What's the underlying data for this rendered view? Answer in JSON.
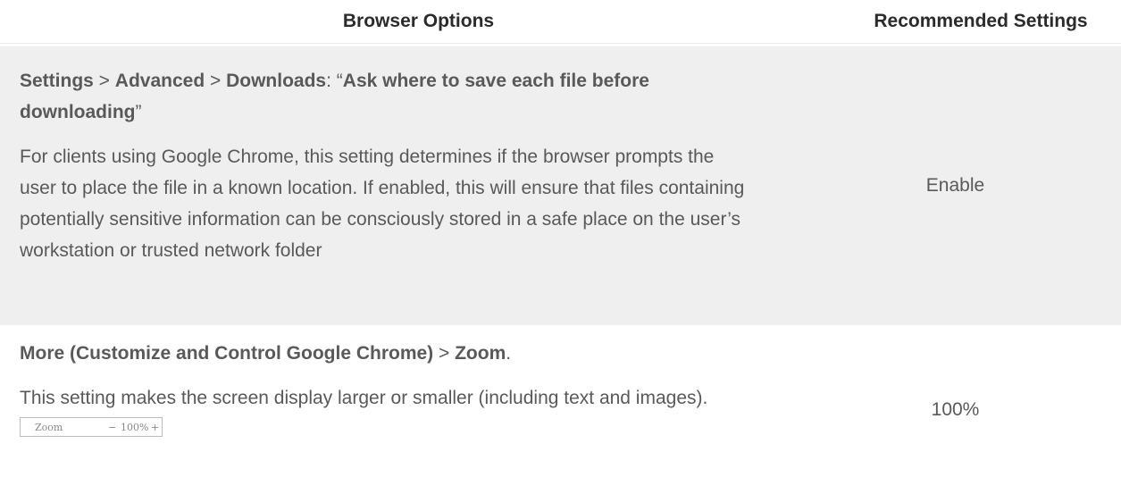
{
  "header": {
    "col1": "Browser Options",
    "col2": "Recommended Settings"
  },
  "rows": [
    {
      "path_a": "Settings",
      "sep_a": " > ",
      "path_b": "Advanced",
      "sep_b": " > ",
      "path_c": "Downloads",
      "sep_c": ": “",
      "path_d": "Ask where to save each file before downloading",
      "sep_d": "”",
      "description": "For clients using Google Chrome, this setting determines if the browser prompts the user to place the file in a known location. If enabled, this will ensure that files containing potentially sensitive information can be consciously stored in a safe place on the user’s workstation or trusted network folder",
      "recommended": "Enable"
    },
    {
      "path_a": "More (Customize and Control Google Chrome)",
      "sep_a": " > ",
      "path_b": "Zoom",
      "sep_b": ".",
      "description": "This setting makes the screen display larger or smaller (including text and images).",
      "recommended": "100%",
      "zoom_widget": {
        "label": "Zoom",
        "minus": "−",
        "value": "100%",
        "plus": "+"
      }
    }
  ]
}
